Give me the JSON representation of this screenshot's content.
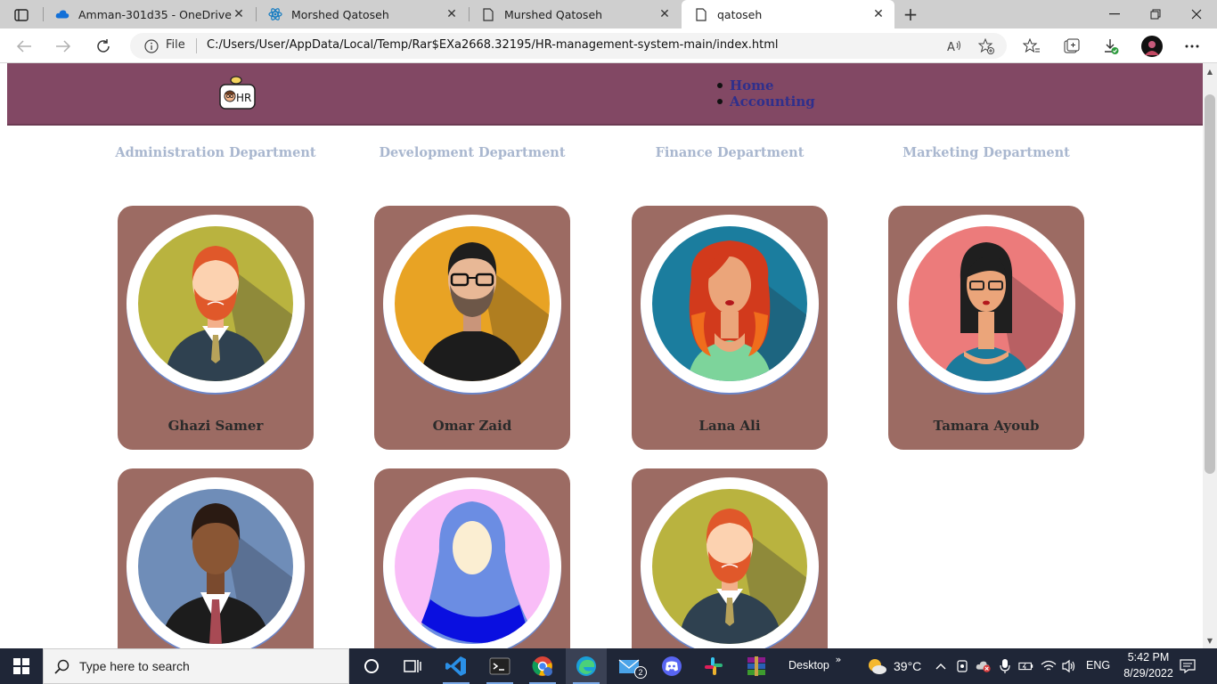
{
  "browser": {
    "tabs": [
      {
        "title": "Amman-301d35 - OneDrive",
        "icon": "onedrive-icon",
        "active": false
      },
      {
        "title": "Morshed Qatoseh",
        "icon": "react-icon",
        "active": false
      },
      {
        "title": "Murshed Qatoseh",
        "icon": "page-icon",
        "active": false
      },
      {
        "title": "qatoseh",
        "icon": "page-icon",
        "active": true
      }
    ],
    "address": {
      "scheme_label": "File",
      "url": "C:/Users/User/AppData/Local/Temp/Rar$EXa2668.32195/HR-management-system-main/index.html"
    }
  },
  "page": {
    "logo_text": "HR",
    "nav": [
      {
        "label": "Home"
      },
      {
        "label": "Accounting"
      }
    ],
    "departments": [
      {
        "label": "Administration Department"
      },
      {
        "label": "Development Department"
      },
      {
        "label": "Finance Department"
      },
      {
        "label": "Marketing Department"
      }
    ],
    "employees": [
      {
        "name": "Ghazi Samer",
        "avatar": "bearded-redhead-man-avatar",
        "bg": "#b9b33f"
      },
      {
        "name": "Omar Zaid",
        "avatar": "bearded-glasses-man-avatar",
        "bg": "#e8a324"
      },
      {
        "name": "Lana Ali",
        "avatar": "red-hair-woman-avatar",
        "bg": "#1b7d9e"
      },
      {
        "name": "Tamara Ayoub",
        "avatar": "glasses-woman-avatar",
        "bg": "#ec7b7b"
      },
      {
        "name": "",
        "avatar": "suited-man-avatar",
        "bg": "#6f8db8"
      },
      {
        "name": "",
        "avatar": "hijab-woman-avatar",
        "bg": "#f9bdf7"
      },
      {
        "name": "",
        "avatar": "bearded-redhead-man-avatar",
        "bg": "#b9b33f"
      }
    ],
    "colors": {
      "header": "#824864",
      "card": "#9c6b63",
      "nav_link": "#2f2f8c",
      "dept_link": "#a9b7cf"
    }
  },
  "taskbar": {
    "search_placeholder": "Type here to search",
    "desktop_label": "Desktop",
    "weather": "39°C",
    "language": "ENG",
    "time": "5:42 PM",
    "date": "8/29/2022",
    "mail_badge": "2"
  }
}
